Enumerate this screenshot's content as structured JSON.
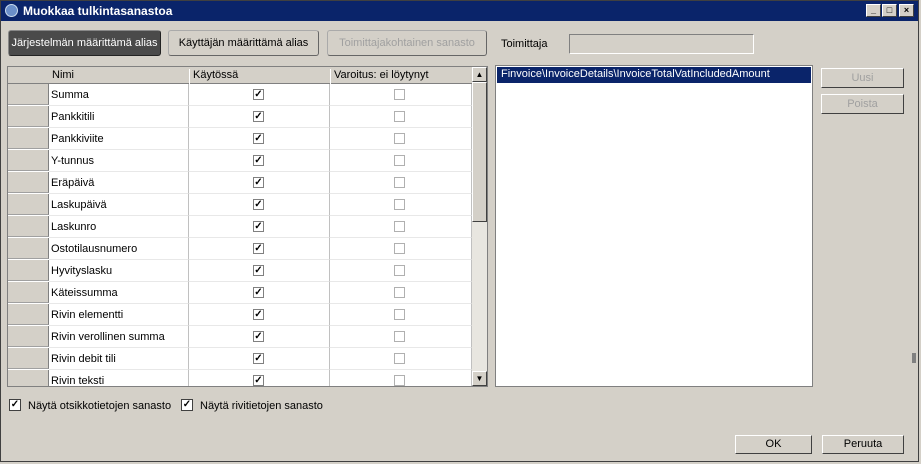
{
  "window": {
    "title": "Muokkaa tulkintasanastoa",
    "controls": {
      "minimize": "_",
      "maximize": "□",
      "close": "×"
    }
  },
  "toolbar": {
    "system_alias_label": "Järjestelmän määrittämä alias",
    "user_alias_label": "Käyttäjän määrittämä alias",
    "supplier_vocab_label": "Toimittajakohtainen sanasto",
    "supplier_label": "Toimittaja",
    "supplier_value": ""
  },
  "grid": {
    "columns": [
      "Nimi",
      "Käytössä",
      "Varoitus: ei löytynyt"
    ],
    "rows": [
      {
        "name": "Summa",
        "enabled": true,
        "warning": false
      },
      {
        "name": "Pankkitili",
        "enabled": true,
        "warning": false
      },
      {
        "name": "Pankkiviite",
        "enabled": true,
        "warning": false
      },
      {
        "name": "Y-tunnus",
        "enabled": true,
        "warning": false
      },
      {
        "name": "Eräpäivä",
        "enabled": true,
        "warning": false
      },
      {
        "name": "Laskupäivä",
        "enabled": true,
        "warning": false
      },
      {
        "name": "Laskunro",
        "enabled": true,
        "warning": false
      },
      {
        "name": "Ostotilausnumero",
        "enabled": true,
        "warning": false
      },
      {
        "name": "Hyvityslasku",
        "enabled": true,
        "warning": false
      },
      {
        "name": "Käteissumma",
        "enabled": true,
        "warning": false
      },
      {
        "name": "Rivin elementti",
        "enabled": true,
        "warning": false
      },
      {
        "name": "Rivin verollinen summa",
        "enabled": true,
        "warning": false
      },
      {
        "name": "Rivin debit tili",
        "enabled": true,
        "warning": false
      },
      {
        "name": "Rivin teksti",
        "enabled": true,
        "warning": false
      }
    ]
  },
  "paths": {
    "items": [
      "Finvoice\\InvoiceDetails\\InvoiceTotalVatIncludedAmount"
    ],
    "new_label": "Uusi",
    "delete_label": "Poista"
  },
  "options": {
    "show_header_vocab_label": "Näytä otsikkotietojen sanasto",
    "show_header_vocab_checked": true,
    "show_row_vocab_label": "Näytä rivitietojen sanasto",
    "show_row_vocab_checked": true
  },
  "footer": {
    "ok_label": "OK",
    "cancel_label": "Peruuta"
  }
}
